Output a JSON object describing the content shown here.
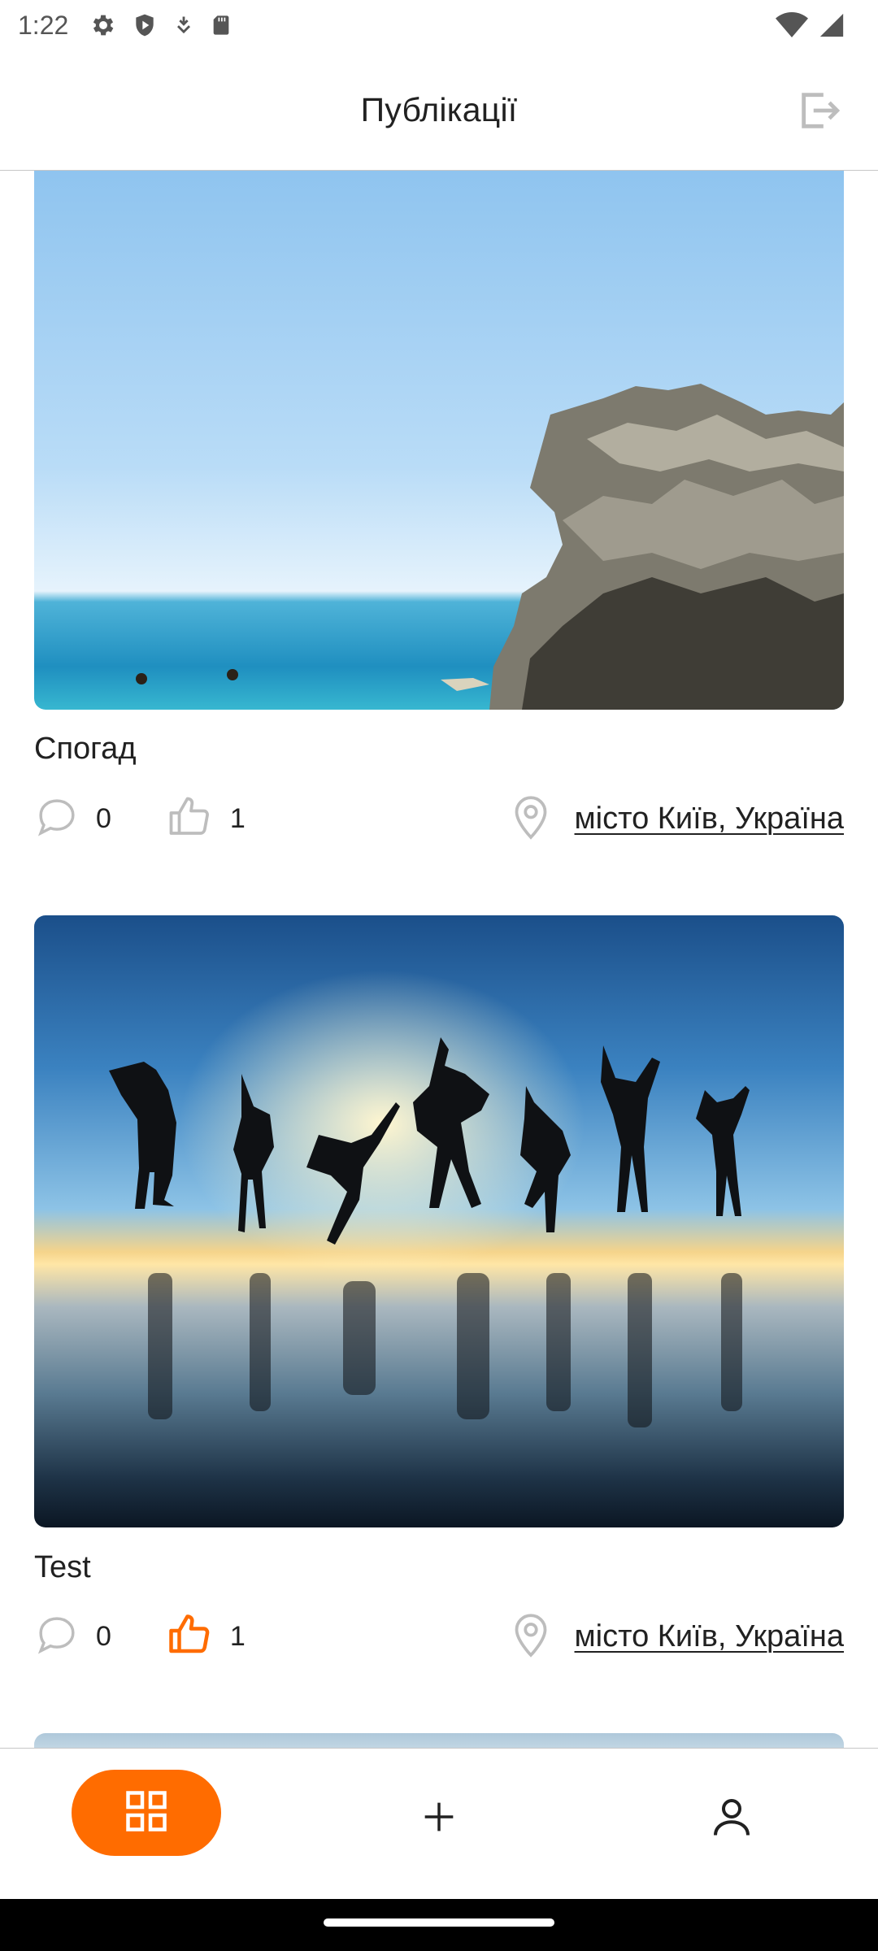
{
  "status_bar": {
    "time": "1:22",
    "icons": [
      "settings-icon",
      "shield-icon",
      "download-icon",
      "sd-card-icon",
      "wifi-icon",
      "signal-icon"
    ]
  },
  "header": {
    "title": "Публікації",
    "logout_icon": "logout-icon"
  },
  "posts": [
    {
      "image": "sea-cliff-photo",
      "title": "Спогад",
      "comments": "0",
      "likes": "1",
      "liked": false,
      "location": "місто Київ, Україна"
    },
    {
      "image": "sunset-jumping-people-photo",
      "title": "Test",
      "comments": "0",
      "likes": "1",
      "liked": true,
      "location": "місто Київ, Україна"
    }
  ],
  "bottom_nav": {
    "items": [
      {
        "icon": "grid-icon",
        "active": true
      },
      {
        "icon": "plus-icon",
        "active": false
      },
      {
        "icon": "user-icon",
        "active": false
      }
    ]
  },
  "colors": {
    "accent": "#FF6C00",
    "text": "#212121",
    "icon_gray": "#BDBDBD",
    "divider": "#C7C7C7"
  }
}
